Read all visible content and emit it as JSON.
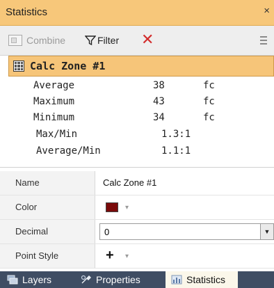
{
  "window": {
    "title": "Statistics",
    "close_glyph": "×"
  },
  "toolbar": {
    "combine_label": "Combine",
    "filter_label": "Filter",
    "delete_glyph": "✕",
    "icons": {
      "combine": "combine-icon",
      "filter": "filter-icon",
      "delete": "delete-icon",
      "more": "more-options-icon"
    }
  },
  "zone": {
    "title": "Calc Zone #1",
    "icon": "grid-icon"
  },
  "stats": [
    {
      "label": "Average",
      "value": "38",
      "unit": "fc"
    },
    {
      "label": "Maximum",
      "value": "43",
      "unit": "fc"
    },
    {
      "label": "Minimum",
      "value": "34",
      "unit": "fc"
    },
    {
      "label": "Max/Min",
      "value": "1.3:1"
    },
    {
      "label": "Average/Min",
      "value": "1.1:1"
    }
  ],
  "properties": {
    "name": {
      "label": "Name",
      "value": "Calc Zone #1"
    },
    "color": {
      "label": "Color",
      "value_hex": "#7a0a0a",
      "caret": "▾"
    },
    "decimal": {
      "label": "Decimal",
      "value": "0",
      "caret": "▼"
    },
    "point_style": {
      "label": "Point Style",
      "value": "+",
      "caret": "▾"
    }
  },
  "tabs": [
    {
      "label": "Layers",
      "icon": "layers-icon",
      "active": false
    },
    {
      "label": "Properties",
      "icon": "properties-icon",
      "active": false
    },
    {
      "label": "Statistics",
      "icon": "statistics-icon",
      "active": true
    }
  ],
  "colors": {
    "title_bar": "#f7c77a",
    "zone_header": "#f6c579",
    "tab_bar": "#3f4d63",
    "active_tab": "#fbf7ea",
    "delete": "#d22b2b"
  }
}
